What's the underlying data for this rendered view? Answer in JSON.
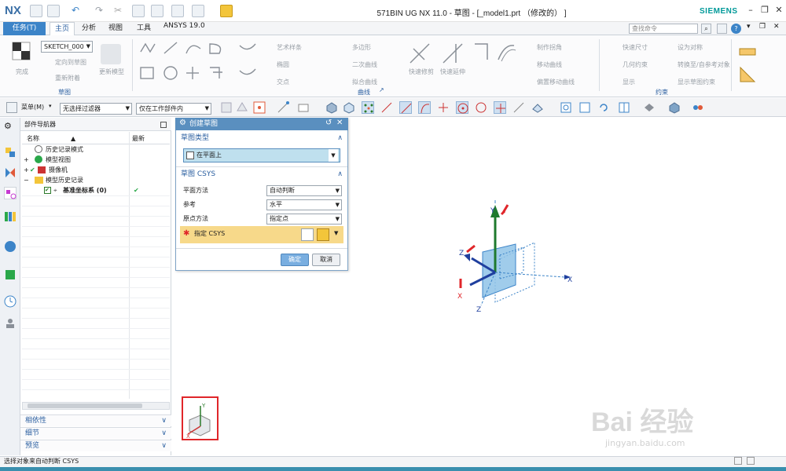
{
  "title_bar": {
    "app_logo": "NX",
    "window_title": "571BIN UG NX 11.0 - 草图 - [_model1.prt （修改的） ]",
    "brand": "SIEMENS"
  },
  "menu": {
    "task_label": "任务(T)",
    "tabs": [
      "主页",
      "分析",
      "视图",
      "工具",
      "ANSYS 19.0"
    ],
    "active_tab": "主页",
    "search_placeholder": "查找命令"
  },
  "ribbon": {
    "sketch_group": {
      "sketch_name": "SKETCH_000",
      "finish": "完成",
      "locate_sketch": "定向到草图",
      "reattach": "重新附着",
      "update_model": "更新模型",
      "label": "草图"
    },
    "curve_group": {
      "items": [
        "艺术样条",
        "多边形",
        "椭圆",
        "二次曲线",
        "交点",
        "拟合曲线",
        "快速修剪",
        "快速延伸",
        "制作拐角",
        "移动曲线",
        "偏置移动曲线"
      ],
      "label": "曲线"
    },
    "constraint_group": {
      "items": [
        "快速尺寸",
        "设为对称",
        "几何约束",
        "转换至/自参考对象",
        "显示草图约束",
        "显示"
      ],
      "label": "约束"
    }
  },
  "toolbar2": {
    "menu_label": "菜单(M)",
    "filter_value": "无选择过滤器",
    "scope_value": "仅在工作部件内"
  },
  "navigator": {
    "title": "部件导航器",
    "col_name": "名称",
    "col_latest": "最新",
    "tree": [
      {
        "label": "历史记录模式",
        "indent": 0
      },
      {
        "label": "模型视图",
        "indent": 0
      },
      {
        "label": "摄像机",
        "indent": 0
      },
      {
        "label": "模型历史记录",
        "indent": 0
      },
      {
        "label": "基准坐标系 (0)",
        "indent": 1,
        "check": "✔"
      }
    ],
    "collapsed_panels": [
      "相依性",
      "细节",
      "预览"
    ]
  },
  "dialog": {
    "title": "创建草图",
    "section_type": "草图类型",
    "sketch_type_value": "在平面上",
    "section_csys": "草图 CSYS",
    "plane_method_label": "平面方法",
    "plane_method_value": "自动判断",
    "reference_label": "参考",
    "reference_value": "水平",
    "origin_method_label": "原点方法",
    "origin_method_value": "指定点",
    "specify_csys_label": "指定 CSYS",
    "ok": "确定",
    "cancel": "取消"
  },
  "viewport": {
    "axis_x": "X",
    "axis_y": "Y",
    "axis_z": "Z",
    "mini_x": "X",
    "mini_y": "Y"
  },
  "status": {
    "message": "选择对象来自动判断 CSYS"
  },
  "watermark": {
    "text": "Bai 经验",
    "sub": "jingyan.baidu.com"
  }
}
